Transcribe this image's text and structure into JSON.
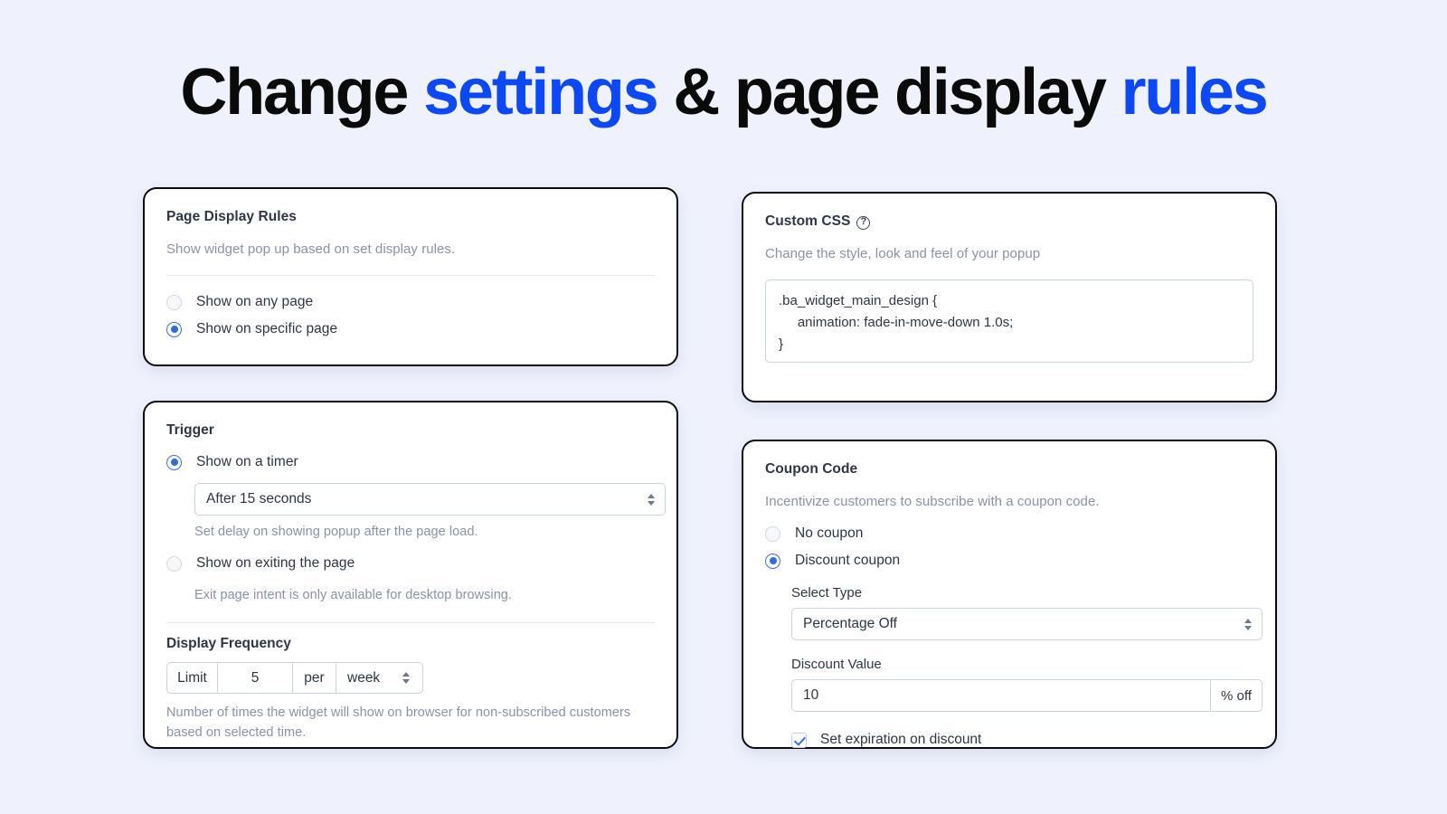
{
  "title": {
    "part1": "Change ",
    "accent1": "settings",
    "part2": " & page display ",
    "accent2": "rules"
  },
  "colors": {
    "accent_blue": "#0c48f5",
    "control_blue": "#2f6ce8",
    "page_background": "#eff2fd",
    "card_border": "#0b0b0b",
    "muted_text": "#8a92a6"
  },
  "page_display_rules": {
    "title": "Page Display Rules",
    "subtitle": "Show widget pop up based on set display rules.",
    "options": [
      {
        "label": "Show on any page",
        "selected": false
      },
      {
        "label": "Show on specific page",
        "selected": true
      }
    ]
  },
  "trigger": {
    "title": "Trigger",
    "options": [
      {
        "label": "Show on a timer",
        "selected": true
      },
      {
        "label": "Show on exiting the page",
        "selected": false
      }
    ],
    "timer_select_value": "After 15 seconds",
    "timer_hint": "Set delay on showing popup after the page load.",
    "exit_hint": "Exit page intent is only available for desktop browsing.",
    "display_frequency": {
      "label": "Display Frequency",
      "limit_label": "Limit",
      "limit_value": "5",
      "per_label": "per",
      "unit_value": "week",
      "hint": "Number of times the widget will show on browser for non-subscribed customers based on selected time."
    }
  },
  "custom_css": {
    "title": "Custom CSS",
    "help_icon": "question-mark-circle-icon",
    "help_glyph": "?",
    "subtitle": "Change the style, look and feel of your popup",
    "code": ".ba_widget_main_design {\n     animation: fade-in-move-down 1.0s;\n}"
  },
  "coupon_code": {
    "title": "Coupon Code",
    "subtitle": "Incentivize customers to subscribe with a coupon code.",
    "options": [
      {
        "label": "No coupon",
        "selected": false
      },
      {
        "label": "Discount coupon",
        "selected": true
      }
    ],
    "select_type_label": "Select Type",
    "select_type_value": "Percentage Off",
    "discount_value_label": "Discount Value",
    "discount_value": "10",
    "discount_suffix": "% off",
    "expiration": {
      "label": "Set expiration on discount",
      "checked": true
    }
  }
}
